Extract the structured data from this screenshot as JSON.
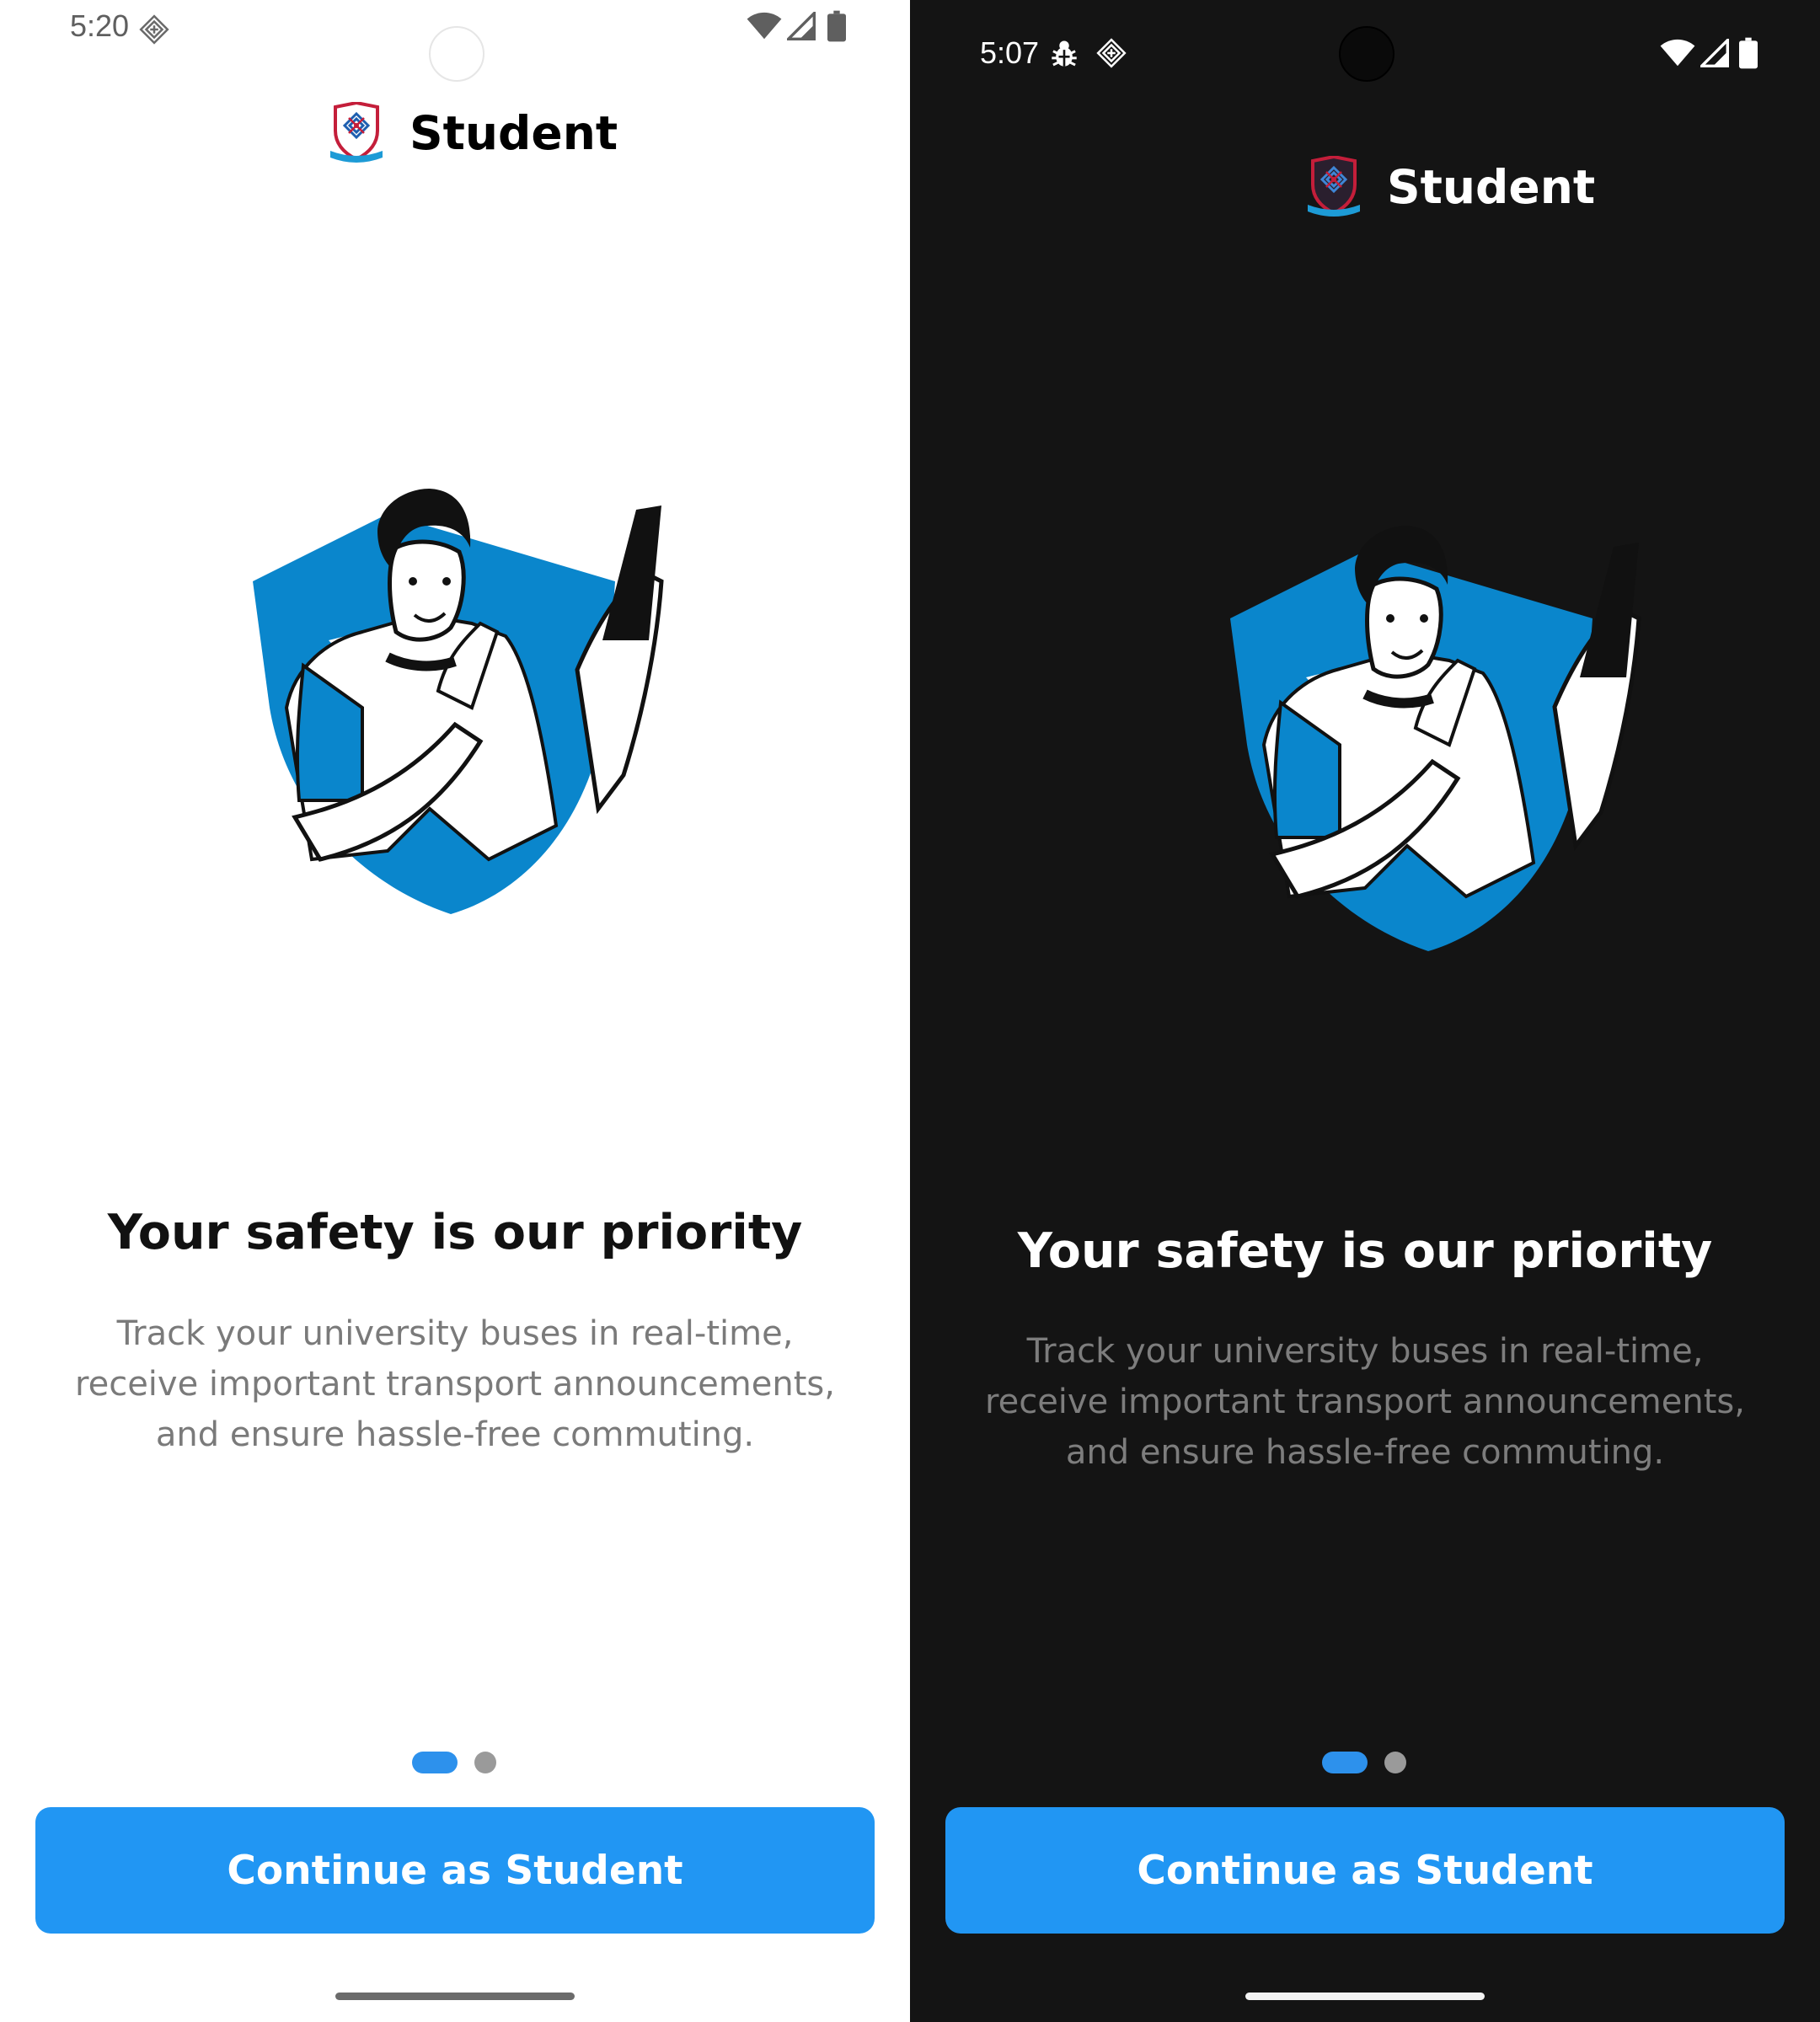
{
  "light": {
    "status": {
      "time": "5:20"
    },
    "header": {
      "title": "Student"
    },
    "onboarding": {
      "heading": "Your safety is our priority",
      "description": "Track your university buses in real-time, receive important transport announcements, and ensure hassle-free commuting."
    },
    "button": {
      "label": "Continue as Student"
    },
    "pager": {
      "current_page": 1,
      "total_pages": 2
    }
  },
  "dark": {
    "status": {
      "time": "5:07"
    },
    "header": {
      "title": "Student"
    },
    "onboarding": {
      "heading": "Your safety is our priority",
      "description": "Track your university buses in real-time, receive important transport announcements, and ensure hassle-free commuting."
    },
    "button": {
      "label": "Continue as Student"
    },
    "pager": {
      "current_page": 1,
      "total_pages": 2
    }
  },
  "colors": {
    "accent": "#2196f3",
    "indicator_active": "#2d91ec",
    "indicator_inactive": "#9a9a9a",
    "illustration_blue": "#0a86cc",
    "dark_background": "#141414"
  },
  "icons": [
    "app-notification-icon",
    "bug-icon",
    "wifi-icon",
    "signal-icon",
    "battery-icon",
    "university-crest-logo"
  ]
}
